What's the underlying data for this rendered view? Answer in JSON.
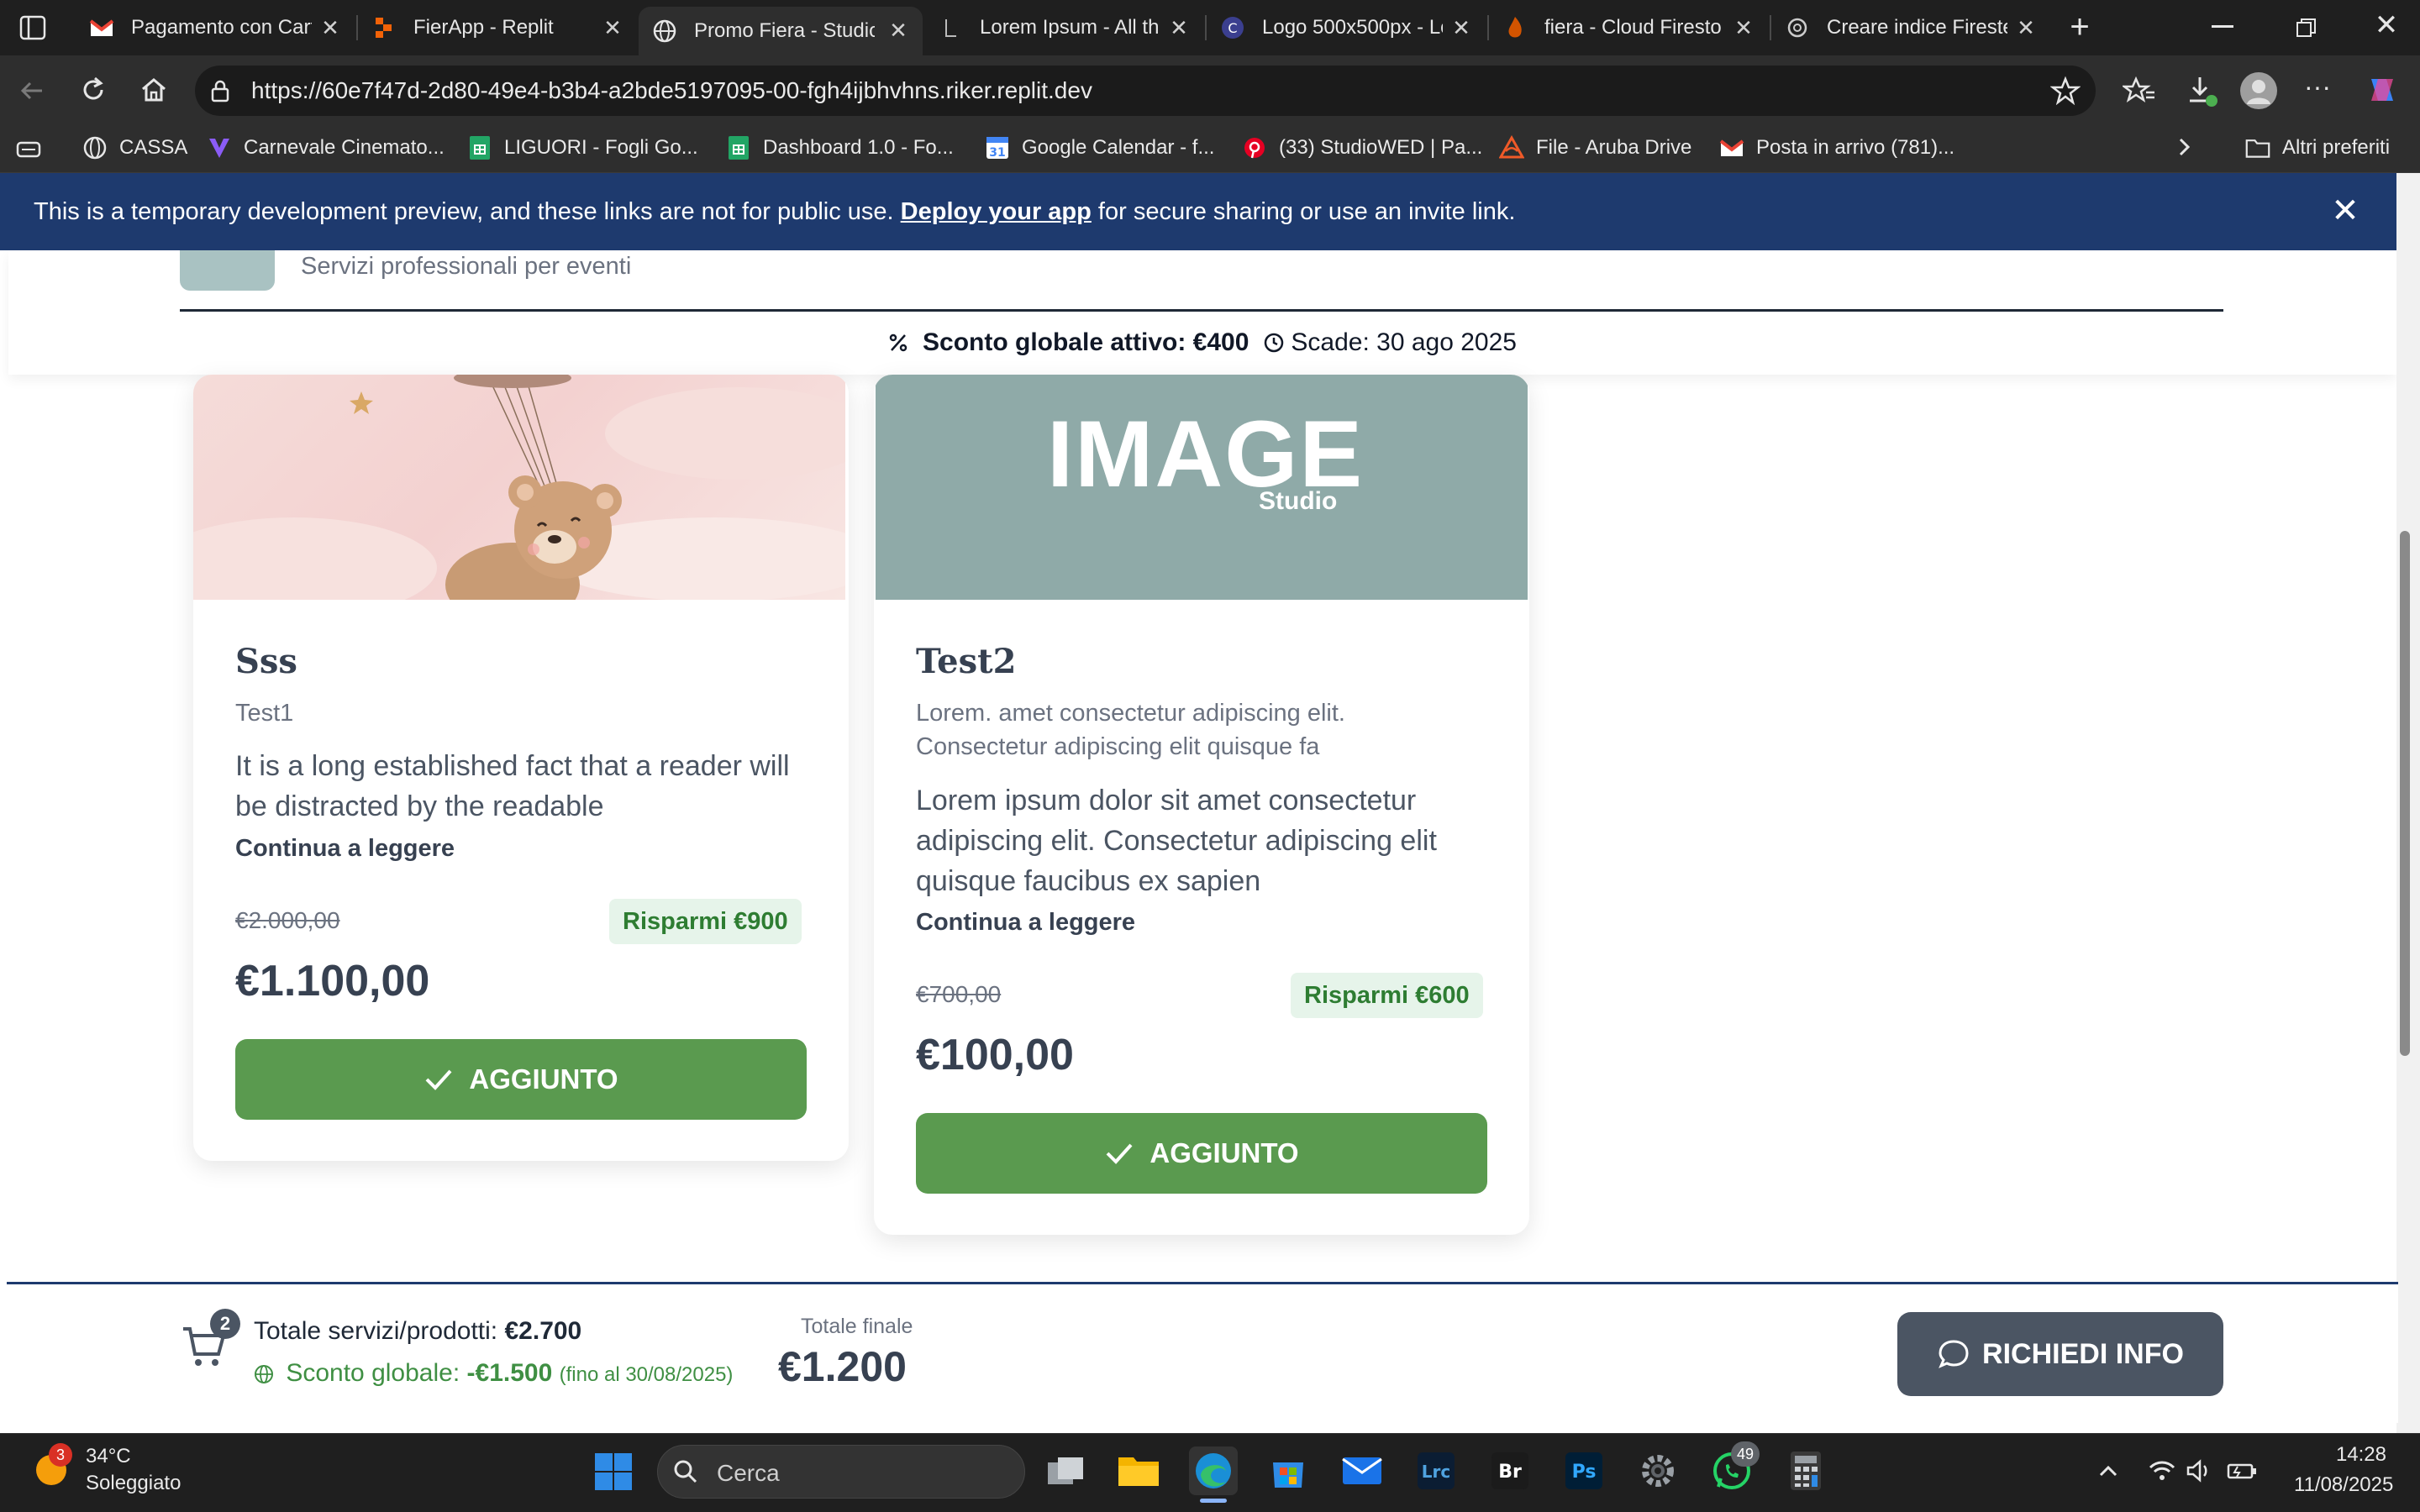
{
  "browser": {
    "tabs": [
      {
        "label": "Pagamento con Cart",
        "icon": "gmail-icon"
      },
      {
        "label": "FierApp - Replit",
        "icon": "replit-icon"
      },
      {
        "label": "Promo Fiera - Studio",
        "icon": "globe-icon",
        "active": true
      },
      {
        "label": "Lorem Ipsum - All th",
        "icon": "lipsum-icon"
      },
      {
        "label": "Logo 500x500px - Lo",
        "icon": "canva-icon"
      },
      {
        "label": "fiera - Cloud Firesto",
        "icon": "firebase-icon"
      },
      {
        "label": "Creare indice Fireste",
        "icon": "chatgpt-icon"
      }
    ],
    "url": "https://60e7f47d-2d80-49e4-b3b4-a2bde5197095-00-fgh4ijbhvhns.riker.replit.dev",
    "bookmarks": [
      {
        "label": "CASSA",
        "icon": "globe-icon"
      },
      {
        "label": "Carnevale Cinemato...",
        "icon": "v-logo-icon"
      },
      {
        "label": "LIGUORI - Fogli Go...",
        "icon": "sheets-icon"
      },
      {
        "label": "Dashboard 1.0 - Fo...",
        "icon": "sheets-icon"
      },
      {
        "label": "Google Calendar - f...",
        "icon": "calendar-icon"
      },
      {
        "label": "(33) StudioWED | Pa...",
        "icon": "pinterest-icon"
      },
      {
        "label": "File - Aruba Drive",
        "icon": "aruba-icon"
      },
      {
        "label": "Posta in arrivo (781)...",
        "icon": "gmail-icon"
      }
    ],
    "other_bookmarks": "Altri preferiti"
  },
  "banner": {
    "text_before": "This is a temporary development preview, and these links are not for public use.",
    "link": "Deploy your app",
    "text_after": "for secure sharing or use an invite link."
  },
  "header": {
    "subtitle": "Servizi professionali per eventi",
    "discount_label": "Sconto globale attivo: €400",
    "expiry": "Scade: 30 ago 2025"
  },
  "cards": [
    {
      "title": "Sss",
      "subtitle": "Test1",
      "description": "It is a long established fact that a reader will be distracted by the readable",
      "read_more": "Continua a leggere",
      "old_price": "€2.000,00",
      "savings": "Risparmi €900",
      "price": "€1.100,00",
      "button": "AGGIUNTO"
    },
    {
      "title": "Test2",
      "subtitle": "Lorem. amet consectetur adipiscing elit. Consectetur adipiscing elit quisque fa",
      "description": "Lorem ipsum dolor sit amet consectetur adipiscing elit. Consectetur adipiscing elit quisque faucibus ex sapien",
      "read_more": "Continua a leggere",
      "old_price": "€700,00",
      "savings": "Risparmi €600",
      "price": "€100,00",
      "button": "AGGIUNTO",
      "image_logo": "IMAGE",
      "image_logo_sub": "Studio"
    }
  ],
  "footer": {
    "cart_count": "2",
    "total_label": "Totale servizi/prodotti:",
    "total_value": "€2.700",
    "discount_label": "Sconto globale:",
    "discount_value": "-€1.500",
    "discount_until": "(fino al 30/08/2025)",
    "final_label": "Totale finale",
    "final_value": "€1.200",
    "info_button": "RICHIEDI INFO"
  },
  "taskbar": {
    "weather_temp": "34°C",
    "weather_desc": "Soleggiato",
    "weather_badge": "3",
    "search": "Cerca",
    "whatsapp_badge": "49",
    "time": "14:28",
    "date": "11/08/2025"
  },
  "colors": {
    "banner": "#1e3a6e",
    "button_green": "#5a9a4f",
    "savings_bg": "#e6f4ea",
    "savings_text": "#2e7d32",
    "info_button": "#4b5563"
  }
}
